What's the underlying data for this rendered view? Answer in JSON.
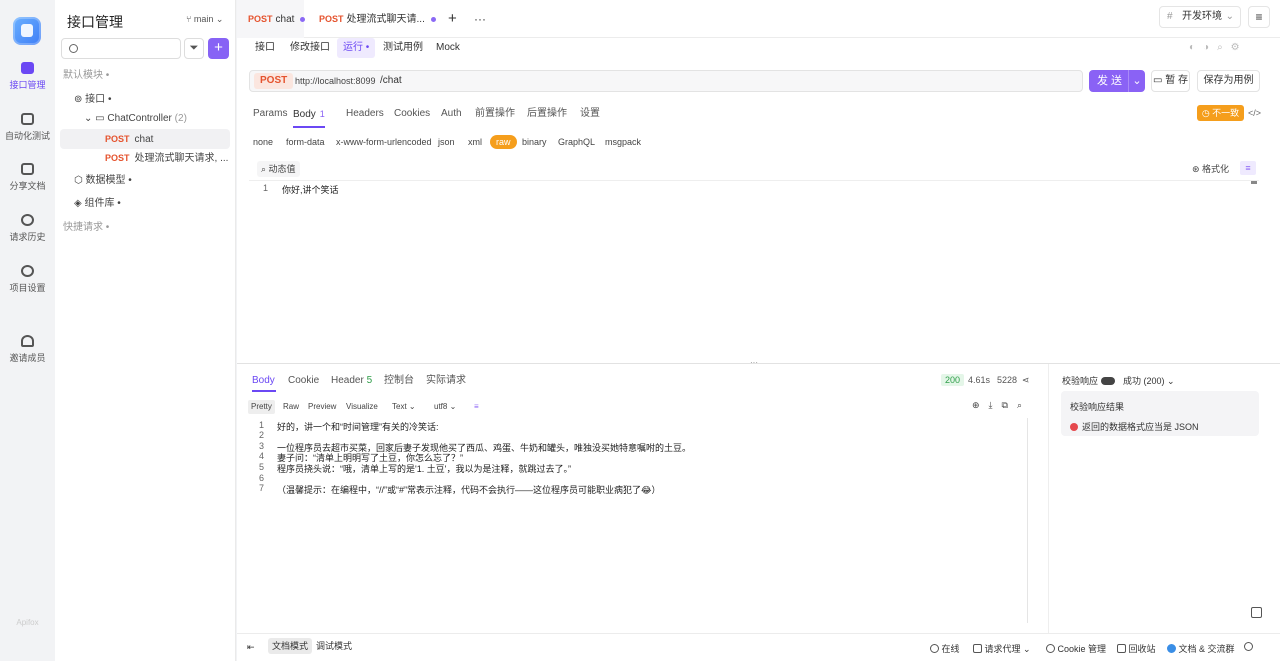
{
  "rail": {
    "items": [
      {
        "label": "接口管理",
        "icon": "api-icon",
        "active": true
      },
      {
        "label": "自动化测试",
        "icon": "stack-icon"
      },
      {
        "label": "分享文档",
        "icon": "book-icon"
      },
      {
        "label": "请求历史",
        "icon": "clock-icon"
      },
      {
        "label": "项目设置",
        "icon": "gear-icon"
      },
      {
        "label": "邀请成员",
        "icon": "add-user-icon"
      }
    ],
    "brand": "Apifox"
  },
  "sidebar": {
    "title": "接口管理",
    "branch": "main",
    "search_placeholder": "",
    "tree": [
      {
        "label": "默认模块",
        "suffix": "•",
        "indent": 0
      },
      {
        "label": "接口",
        "suffix": "•",
        "indent": 1
      },
      {
        "label": "ChatController",
        "count": "(2)",
        "indent": 2
      },
      {
        "method": "POST",
        "label": "chat",
        "indent": 3,
        "selected": true
      },
      {
        "method": "POST",
        "label": "处理流式聊天请求, ...",
        "indent": 3
      },
      {
        "label": "数据模型",
        "suffix": "•",
        "indent": 1
      },
      {
        "label": "组件库",
        "suffix": "•",
        "indent": 1
      },
      {
        "label": "快捷请求",
        "suffix": "•",
        "indent": 0
      }
    ]
  },
  "tabs": [
    {
      "method": "POST",
      "label": "chat",
      "active": true
    },
    {
      "method": "POST",
      "label": "处理流式聊天请..."
    }
  ],
  "env": "开发环境",
  "subtabs": [
    "接口",
    "修改接口",
    "运行",
    "测试用例",
    "Mock"
  ],
  "active_subtab": "运行",
  "request": {
    "method": "POST",
    "base_url": "http://localhost:8099",
    "path": "/chat",
    "send_label": "发 送",
    "save_label": "暂 存",
    "save_case_label": "保存为用例",
    "tabs": [
      "Params",
      "Body",
      "Headers",
      "Cookies",
      "Auth",
      "前置操作",
      "后置操作",
      "设置"
    ],
    "body_badge": "1",
    "inconsistent": "不一致",
    "body_types": [
      "none",
      "form-data",
      "x-www-form-urlencoded",
      "json",
      "xml",
      "raw",
      "binary",
      "GraphQL",
      "msgpack"
    ],
    "active_body_type": "raw",
    "dynamic_value": "动态值",
    "format_label": "格式化",
    "code_lines": [
      "你好,讲个笑话"
    ]
  },
  "response": {
    "tabs": [
      "Body",
      "Cookie",
      "Header",
      "控制台",
      "实际请求"
    ],
    "header_count": "5",
    "status": "200",
    "time": "4.61s",
    "size": "5228",
    "view_tabs": [
      "Pretty",
      "Raw",
      "Preview",
      "Visualize"
    ],
    "format": "Text",
    "encoding": "utf8",
    "lines": [
      "好的，讲一个和“时间管理”有关的冷笑话:",
      "",
      "一位程序员去超市买菜，回家后妻子发现他买了西瓜、鸡蛋、牛奶和罐头，唯独没买她特意嘱咐的土豆。",
      "妻子问：“清单上明明写了土豆，你怎么忘了？”",
      "程序员挠头说：“哦，清单上写的是'1. 土豆'，我以为是注释，就跳过去了。”",
      "",
      "（温馨提示：在编程中，“//”或“#”常表示注释，代码不会执行——这位程序员可能职业病犯了😂）"
    ],
    "validate_label": "校验响应",
    "validate_status": "成功 (200)",
    "result_title": "校验响应结果",
    "result_error": "返回的数据格式应当是 JSON"
  },
  "footer": {
    "modes": [
      "文档模式",
      "调试模式"
    ],
    "items": [
      "在线",
      "请求代理",
      "Cookie 管理",
      "回收站",
      "文档 & 交流群"
    ]
  }
}
